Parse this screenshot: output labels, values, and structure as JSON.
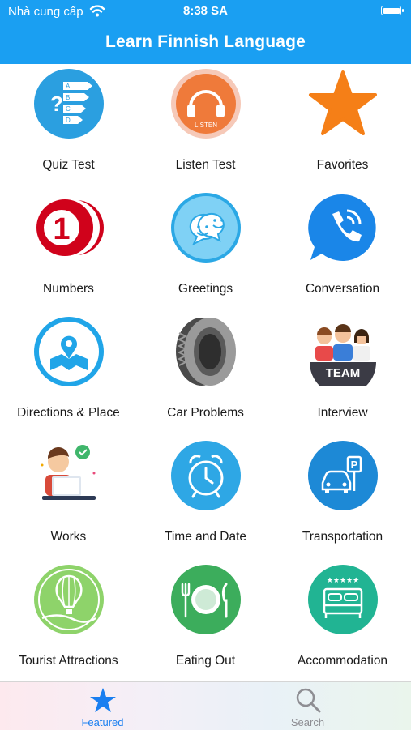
{
  "status_bar": {
    "carrier": "Nhà cung cấp",
    "time": "8:38 SA",
    "icons": [
      "wifi-icon",
      "battery-icon"
    ]
  },
  "header": {
    "title": "Learn Finnish Language",
    "background_color": "#1a9ff2"
  },
  "grid": {
    "items": [
      {
        "label": "Quiz Test",
        "icon": "quiz-icon"
      },
      {
        "label": "Listen Test",
        "icon": "headphones-icon",
        "icon_text": "LISTEN"
      },
      {
        "label": "Favorites",
        "icon": "star-icon"
      },
      {
        "label": "Numbers",
        "icon": "number-one-icon",
        "icon_text": "1"
      },
      {
        "label": "Greetings",
        "icon": "smiley-chat-icon"
      },
      {
        "label": "Conversation",
        "icon": "phone-chat-icon"
      },
      {
        "label": "Directions & Place",
        "icon": "map-pin-icon"
      },
      {
        "label": "Car Problems",
        "icon": "tire-icon"
      },
      {
        "label": "Interview",
        "icon": "team-icon",
        "icon_text": "TEAM"
      },
      {
        "label": "Works",
        "icon": "laptop-worker-icon"
      },
      {
        "label": "Time and Date",
        "icon": "alarm-clock-icon"
      },
      {
        "label": "Transportation",
        "icon": "car-parking-icon",
        "icon_text": "P"
      },
      {
        "label": "Tourist Attractions",
        "icon": "hot-air-balloon-icon"
      },
      {
        "label": "Eating Out",
        "icon": "plate-cutlery-icon"
      },
      {
        "label": "Accommodation",
        "icon": "hotel-bed-icon",
        "icon_text": "★★★★★"
      }
    ]
  },
  "tabbar": {
    "tabs": [
      {
        "label": "Featured",
        "icon": "star-icon",
        "selected": true,
        "color": "#1a7ff0"
      },
      {
        "label": "Search",
        "icon": "search-icon",
        "selected": false,
        "color": "#8e8e93"
      }
    ]
  }
}
